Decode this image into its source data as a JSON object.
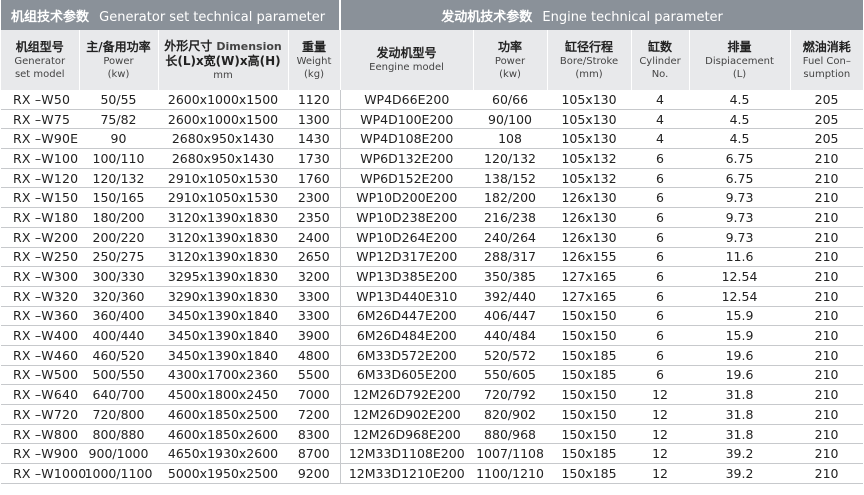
{
  "header": {
    "left_zh": "机组技术参数",
    "left_en": "Generator set technical parameter",
    "right_zh": "发动机技术参数",
    "right_en": "Engine technical parameter"
  },
  "columns": [
    {
      "zh": "机组型号",
      "en1": "Generator",
      "en2": "set model"
    },
    {
      "zh": "主/备用功率",
      "en1": "Power",
      "en2": "(kw)"
    },
    {
      "zh": "外形尺寸",
      "zh_suffix": "Dimension",
      "zh2": "长(L)x宽(W)x高(H)",
      "en2": "mm"
    },
    {
      "zh": "重量",
      "en1": "Weight",
      "en2": "(kg)"
    },
    {
      "zh": "发动机型号",
      "en1": "Eengine model",
      "en2": ""
    },
    {
      "zh": "功率",
      "en1": "Power",
      "en2": "(kw)"
    },
    {
      "zh": "缸径行程",
      "en1": "Bore/Stroke",
      "en2": "(mm)"
    },
    {
      "zh": "缸数",
      "en1": "Cylinder",
      "en2": "No."
    },
    {
      "zh": "排量",
      "en1": "Dispiacement",
      "en2": "(L)"
    },
    {
      "zh": "燃油消耗",
      "en1": "Fuel Con–",
      "en2": "sumption"
    }
  ],
  "rows": [
    [
      "RX –W50",
      "50/55",
      "2600x1000x1500",
      "1120",
      "WP4D66E200",
      "60/66",
      "105x130",
      "4",
      "4.5",
      "205"
    ],
    [
      "RX –W75",
      "75/82",
      "2600x1000x1500",
      "1300",
      "WP4D100E200",
      "90/100",
      "105x130",
      "4",
      "4.5",
      "205"
    ],
    [
      "RX –W90E",
      "90",
      "2680x950x1430",
      "1430",
      "WP4D108E200",
      "108",
      "105x130",
      "4",
      "4.5",
      "205"
    ],
    [
      "RX –W100",
      "100/110",
      "2680x950x1430",
      "1730",
      "WP6D132E200",
      "120/132",
      "105x132",
      "6",
      "6.75",
      "210"
    ],
    [
      "RX –W120",
      "120/132",
      "2910x1050x1530",
      "1760",
      "WP6D152E200",
      "138/152",
      "105x132",
      "6",
      "6.75",
      "210"
    ],
    [
      "RX –W150",
      "150/165",
      "2910x1050x1530",
      "2300",
      "WP10D200E200",
      "182/200",
      "126x130",
      "6",
      "9.73",
      "210"
    ],
    [
      "RX –W180",
      "180/200",
      "3120x1390x1830",
      "2350",
      "WP10D238E200",
      "216/238",
      "126x130",
      "6",
      "9.73",
      "210"
    ],
    [
      "RX –W200",
      "200/220",
      "3120x1390x1830",
      "2400",
      "WP10D264E200",
      "240/264",
      "126x130",
      "6",
      "9.73",
      "210"
    ],
    [
      "RX –W250",
      "250/275",
      "3120x1390x1830",
      "2650",
      "WP12D317E200",
      "288/317",
      "126x155",
      "6",
      "11.6",
      "210"
    ],
    [
      "RX –W300",
      "300/330",
      "3295x1390x1830",
      "3200",
      "WP13D385E200",
      "350/385",
      "127x165",
      "6",
      "12.54",
      "210"
    ],
    [
      "RX –W320",
      "320/360",
      "3290x1390x1830",
      "3300",
      "WP13D440E310",
      "392/440",
      "127x165",
      "6",
      "12.54",
      "210"
    ],
    [
      "RX –W360",
      "360/400",
      "3450x1390x1840",
      "3300",
      "6M26D447E200",
      "406/447",
      "150x150",
      "6",
      "15.9",
      "210"
    ],
    [
      "RX –W400",
      "400/440",
      "3450x1390x1840",
      "3900",
      "6M26D484E200",
      "440/484",
      "150x150",
      "6",
      "15.9",
      "210"
    ],
    [
      "RX –W460",
      "460/520",
      "3450x1390x1840",
      "4800",
      "6M33D572E200",
      "520/572",
      "150x185",
      "6",
      "19.6",
      "210"
    ],
    [
      "RX –W500",
      "500/550",
      "4300x1700x2360",
      "5500",
      "6M33D605E200",
      "550/605",
      "150x185",
      "6",
      "19.6",
      "210"
    ],
    [
      "RX –W640",
      "640/700",
      "4500x1800x2450",
      "7000",
      "12M26D792E200",
      "720/792",
      "150x150",
      "12",
      "31.8",
      "210"
    ],
    [
      "RX –W720",
      "720/800",
      "4600x1850x2500",
      "7200",
      "12M26D902E200",
      "820/902",
      "150x150",
      "12",
      "31.8",
      "210"
    ],
    [
      "RX –W800",
      "800/880",
      "4600x1850x2600",
      "8300",
      "12M26D968E200",
      "880/968",
      "150x150",
      "12",
      "31.8",
      "210"
    ],
    [
      "RX –W900",
      "900/1000",
      "4650x1930x2600",
      "8700",
      "12M33D1108E200",
      "1007/1108",
      "150x185",
      "12",
      "39.2",
      "210"
    ],
    [
      "RX –W1000",
      "1000/1100",
      "5000x1950x2500",
      "9200",
      "12M33D1210E200",
      "1100/1210",
      "150x185",
      "12",
      "39.2",
      "210"
    ]
  ]
}
